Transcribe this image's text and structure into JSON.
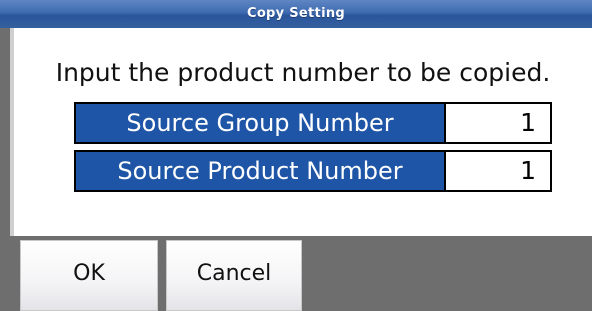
{
  "window": {
    "title": "Copy Setting"
  },
  "main": {
    "instruction": "Input the product number to be copied.",
    "fields": [
      {
        "label": "Source Group Number",
        "value": "1"
      },
      {
        "label": "Source Product Number",
        "value": "1"
      }
    ]
  },
  "buttons": {
    "ok_label": "OK",
    "cancel_label": "Cancel"
  },
  "colors": {
    "titlebar": "#3e6bb0",
    "field_label_bg": "#1f55a6",
    "button_bar_bg": "#6e6e6e"
  }
}
